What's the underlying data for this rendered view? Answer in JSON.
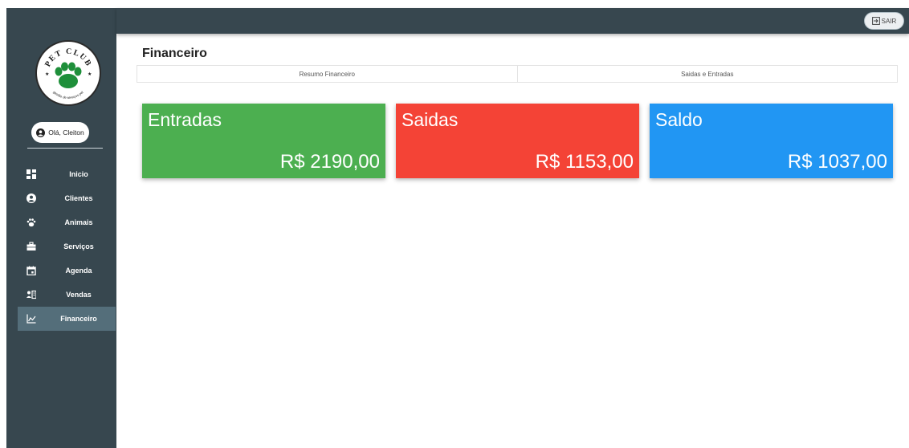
{
  "logo": {
    "top_text": "PET CLUB",
    "bottom_text": "gestão de serviços pet"
  },
  "user": {
    "greeting": "Olá, Cleiton"
  },
  "sidebar": {
    "items": [
      {
        "label": "Inicio",
        "icon": "dashboard-icon"
      },
      {
        "label": "Clientes",
        "icon": "user-circle-icon"
      },
      {
        "label": "Animais",
        "icon": "paw-icon"
      },
      {
        "label": "Serviços",
        "icon": "briefcase-icon"
      },
      {
        "label": "Agenda",
        "icon": "calendar-icon"
      },
      {
        "label": "Vendas",
        "icon": "sales-icon"
      },
      {
        "label": "Financeiro",
        "icon": "chart-line-icon",
        "active": true
      }
    ]
  },
  "topbar": {
    "logout_label": "SAIR"
  },
  "page": {
    "title": "Financeiro"
  },
  "tabs": [
    {
      "label": "Resumo Financeiro"
    },
    {
      "label": "Saidas e Entradas"
    }
  ],
  "cards": {
    "entradas": {
      "title": "Entradas",
      "value": "R$ 2190,00"
    },
    "saidas": {
      "title": "Saidas",
      "value": "R$ 1153,00"
    },
    "saldo": {
      "title": "Saldo",
      "value": "R$ 1037,00"
    }
  },
  "colors": {
    "sidebar_bg": "#37474f",
    "entradas": "#4caf50",
    "saidas": "#f44336",
    "saldo": "#2196f3",
    "logo_green": "#1e8f3a"
  }
}
